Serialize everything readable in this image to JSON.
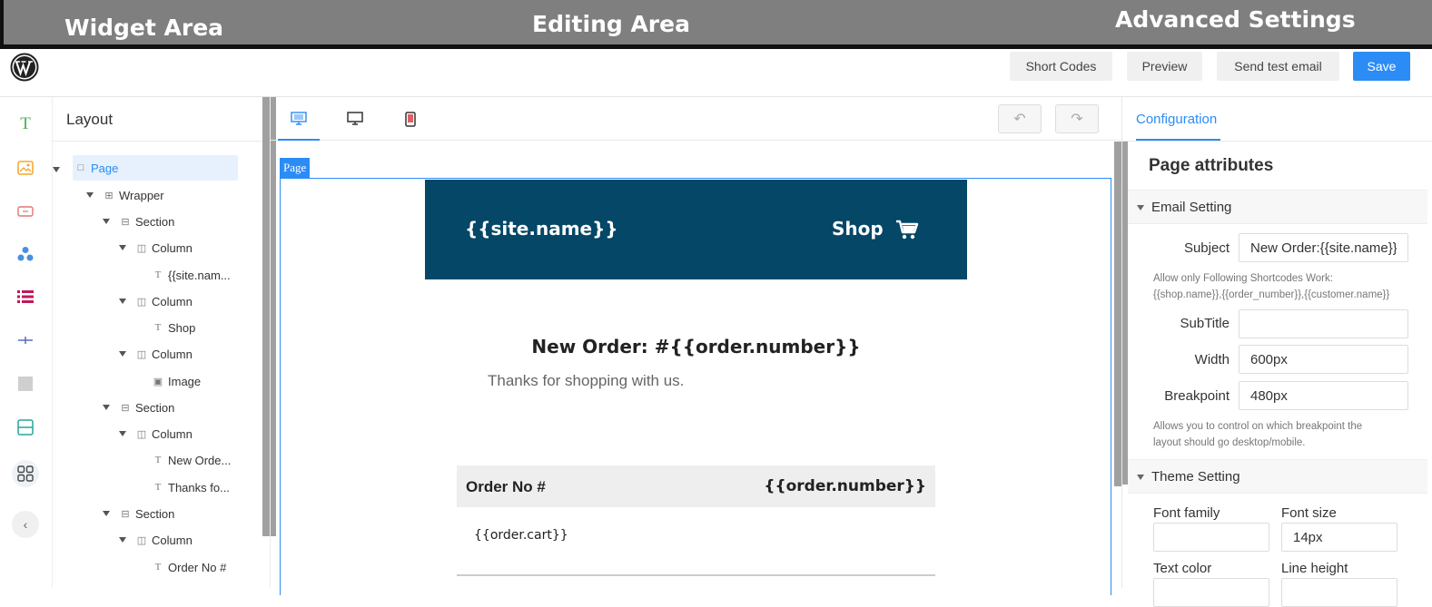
{
  "banner": {
    "widget": "Widget Area",
    "editing": "Editing Area",
    "advanced": "Advanced Settings"
  },
  "toolbar": {
    "short_codes": "Short Codes",
    "preview": "Preview",
    "send_test": "Send test email",
    "save": "Save"
  },
  "iconbar": [
    "text-icon",
    "image-icon",
    "button-icon",
    "social-icon",
    "list-icon",
    "divider-icon",
    "spacer-icon",
    "section-icon",
    "grid-icon"
  ],
  "layout": {
    "title": "Layout",
    "tree": [
      {
        "label": "Page",
        "icon": "page-icon"
      },
      {
        "label": "Wrapper",
        "icon": "wrapper-icon"
      },
      {
        "label": "Section",
        "icon": "section-icon"
      },
      {
        "label": "Column",
        "icon": "column-icon"
      },
      {
        "label": "{{site.nam...",
        "icon": "text-icon"
      },
      {
        "label": "Column",
        "icon": "column-icon"
      },
      {
        "label": "Shop",
        "icon": "text-icon"
      },
      {
        "label": "Column",
        "icon": "column-icon"
      },
      {
        "label": "Image",
        "icon": "image-icon"
      },
      {
        "label": "Section",
        "icon": "section-icon"
      },
      {
        "label": "Column",
        "icon": "column-icon"
      },
      {
        "label": "New Orde...",
        "icon": "text-icon"
      },
      {
        "label": "Thanks fo...",
        "icon": "text-icon"
      },
      {
        "label": "Section",
        "icon": "section-icon"
      },
      {
        "label": "Column",
        "icon": "column-icon"
      },
      {
        "label": "Order No #",
        "icon": "text-icon"
      }
    ]
  },
  "editor": {
    "page_tag": "Page",
    "site_name": "{{site.name}}",
    "shop": "Shop",
    "order_title": "New Order: #{{order.number}}",
    "thanks": "Thanks for shopping with us.",
    "order_no_label": "Order No #",
    "order_no_value": "{{order.number}}",
    "cart": "{{order.cart}}",
    "colors": {
      "header_bg": "#044767",
      "accent": "#2b8cf5"
    }
  },
  "config": {
    "tab": "Configuration",
    "page_attributes": "Page attributes",
    "email_setting": "Email Setting",
    "subject_label": "Subject",
    "subject_value": "New Order:{{site.name}}",
    "subject_hint_1": "Allow only Following Shortcodes Work:",
    "subject_hint_2": "{{shop.name}},{{order_number}},{{customer.name}}",
    "subtitle_label": "SubTitle",
    "subtitle_value": "",
    "width_label": "Width",
    "width_value": "600px",
    "breakpoint_label": "Breakpoint",
    "breakpoint_value": "480px",
    "breakpoint_hint_1": "Allows you to control on which breakpoint the",
    "breakpoint_hint_2": "layout should go desktop/mobile.",
    "theme_setting": "Theme Setting",
    "font_family_label": "Font family",
    "font_family_value": "",
    "font_size_label": "Font size",
    "font_size_value": "14px",
    "text_color_label": "Text color",
    "line_height_label": "Line height"
  }
}
